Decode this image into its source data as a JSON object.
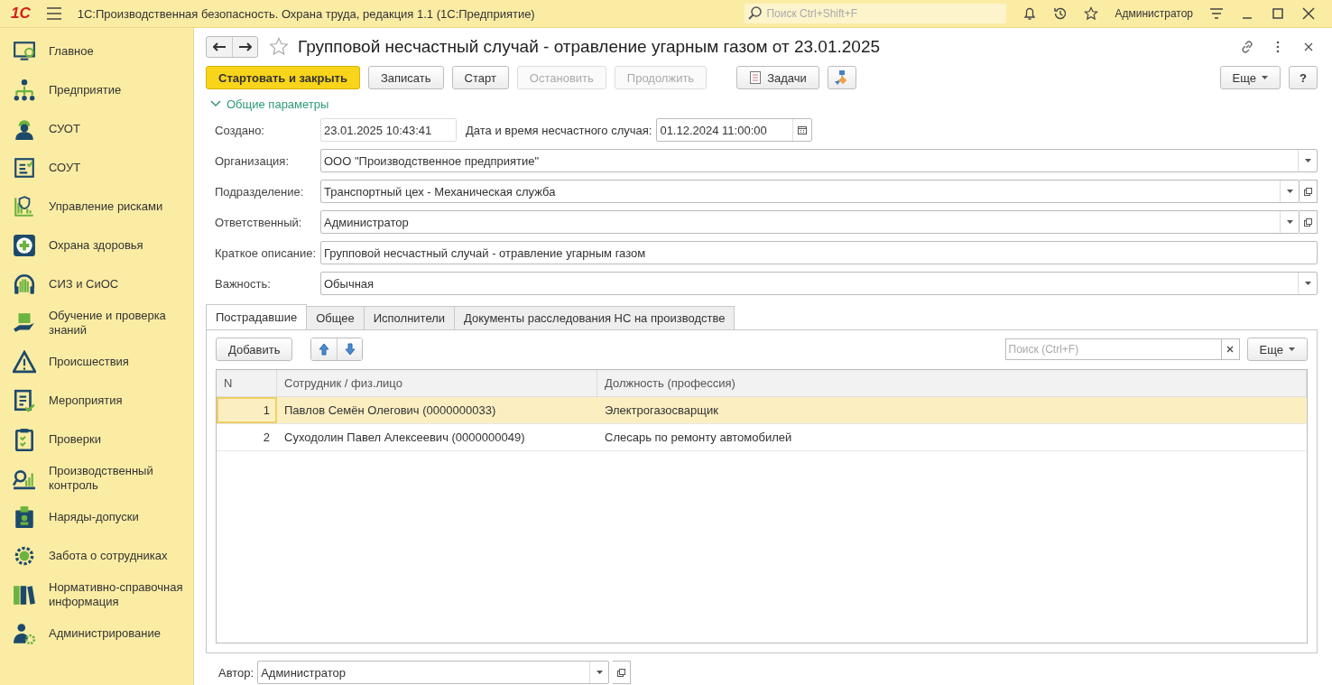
{
  "app_bar": {
    "logo": "1С",
    "title": "1С:Производственная безопасность. Охрана труда, редакция 1.1  (1С:Предприятие)",
    "search": {
      "placeholder": "Поиск Ctrl+Shift+F"
    },
    "user": "Администратор"
  },
  "sidebar": {
    "items": [
      {
        "label": "Главное"
      },
      {
        "label": "Предприятие"
      },
      {
        "label": "СУОТ"
      },
      {
        "label": "СОУТ"
      },
      {
        "label": "Управление рисками"
      },
      {
        "label": "Охрана здоровья"
      },
      {
        "label": "СИЗ и СиОС"
      },
      {
        "label": "Обучение и проверка знаний"
      },
      {
        "label": "Происшествия"
      },
      {
        "label": "Мероприятия"
      },
      {
        "label": "Проверки"
      },
      {
        "label": "Производственный контроль"
      },
      {
        "label": "Наряды-допуски"
      },
      {
        "label": "Забота о сотрудниках"
      },
      {
        "label": "Нормативно-справочная информация"
      },
      {
        "label": "Администрирование"
      }
    ]
  },
  "form": {
    "title": "Групповой несчастный случай - отравление угарным газом от 23.01.2025",
    "favorite": false,
    "buttons": [
      {
        "label": "Стартовать и закрыть",
        "primary": true,
        "disabled": false
      },
      {
        "label": "Записать",
        "primary": false,
        "disabled": false
      },
      {
        "label": "Старт",
        "primary": false,
        "disabled": false
      },
      {
        "label": "Остановить",
        "primary": false,
        "disabled": true
      },
      {
        "label": "Продолжить",
        "primary": false,
        "disabled": true
      }
    ],
    "tasks_button": "Задачи",
    "more_button": "Еще",
    "help_button": "?",
    "section": {
      "label": "Общие параметры",
      "expanded": true
    },
    "created": {
      "label": "Создано:",
      "value": "23.01.2025 10:43:41"
    },
    "incident_date": {
      "label": "Дата и время несчастного случая:",
      "value": "01.12.2024 11:00:00"
    },
    "fields": [
      {
        "label": "Организация:",
        "value": "ООО \"Производственное предприятие\"",
        "kind": "dropdown"
      },
      {
        "label": "Подразделение:",
        "value": "Транспортный цех - Механическая служба",
        "kind": "reference"
      },
      {
        "label": "Ответственный:",
        "value": "Администратор",
        "kind": "reference"
      },
      {
        "label": "Краткое описание:",
        "value": "Групповой несчастный случай - отравление угарным газом",
        "kind": "text"
      },
      {
        "label": "Важность:",
        "value": "Обычная",
        "kind": "dropdown"
      }
    ],
    "tabs": [
      {
        "label": "Пострадавшие",
        "selected": true
      },
      {
        "label": "Общее",
        "selected": false
      },
      {
        "label": "Исполнители",
        "selected": false
      },
      {
        "label": "Документы расследования НС на производстве",
        "selected": false
      }
    ],
    "table_toolbar": {
      "add_button": "Добавить",
      "search": {
        "placeholder": "Поиск (Ctrl+F)"
      },
      "more_button": "Еще"
    },
    "table": {
      "columns": [
        "N",
        "Сотрудник / физ.лицо",
        "Должность (профессия)"
      ],
      "rows": [
        {
          "n": "1",
          "employee": "Павлов Семён Олегович (0000000033)",
          "position": "Электрогазосварщик",
          "selected": true
        },
        {
          "n": "2",
          "employee": "Суходолин Павел Алексеевич (0000000049)",
          "position": "Слесарь по ремонту автомобилей",
          "selected": false
        }
      ]
    },
    "author": {
      "label": "Автор:",
      "value": "Администратор"
    }
  }
}
